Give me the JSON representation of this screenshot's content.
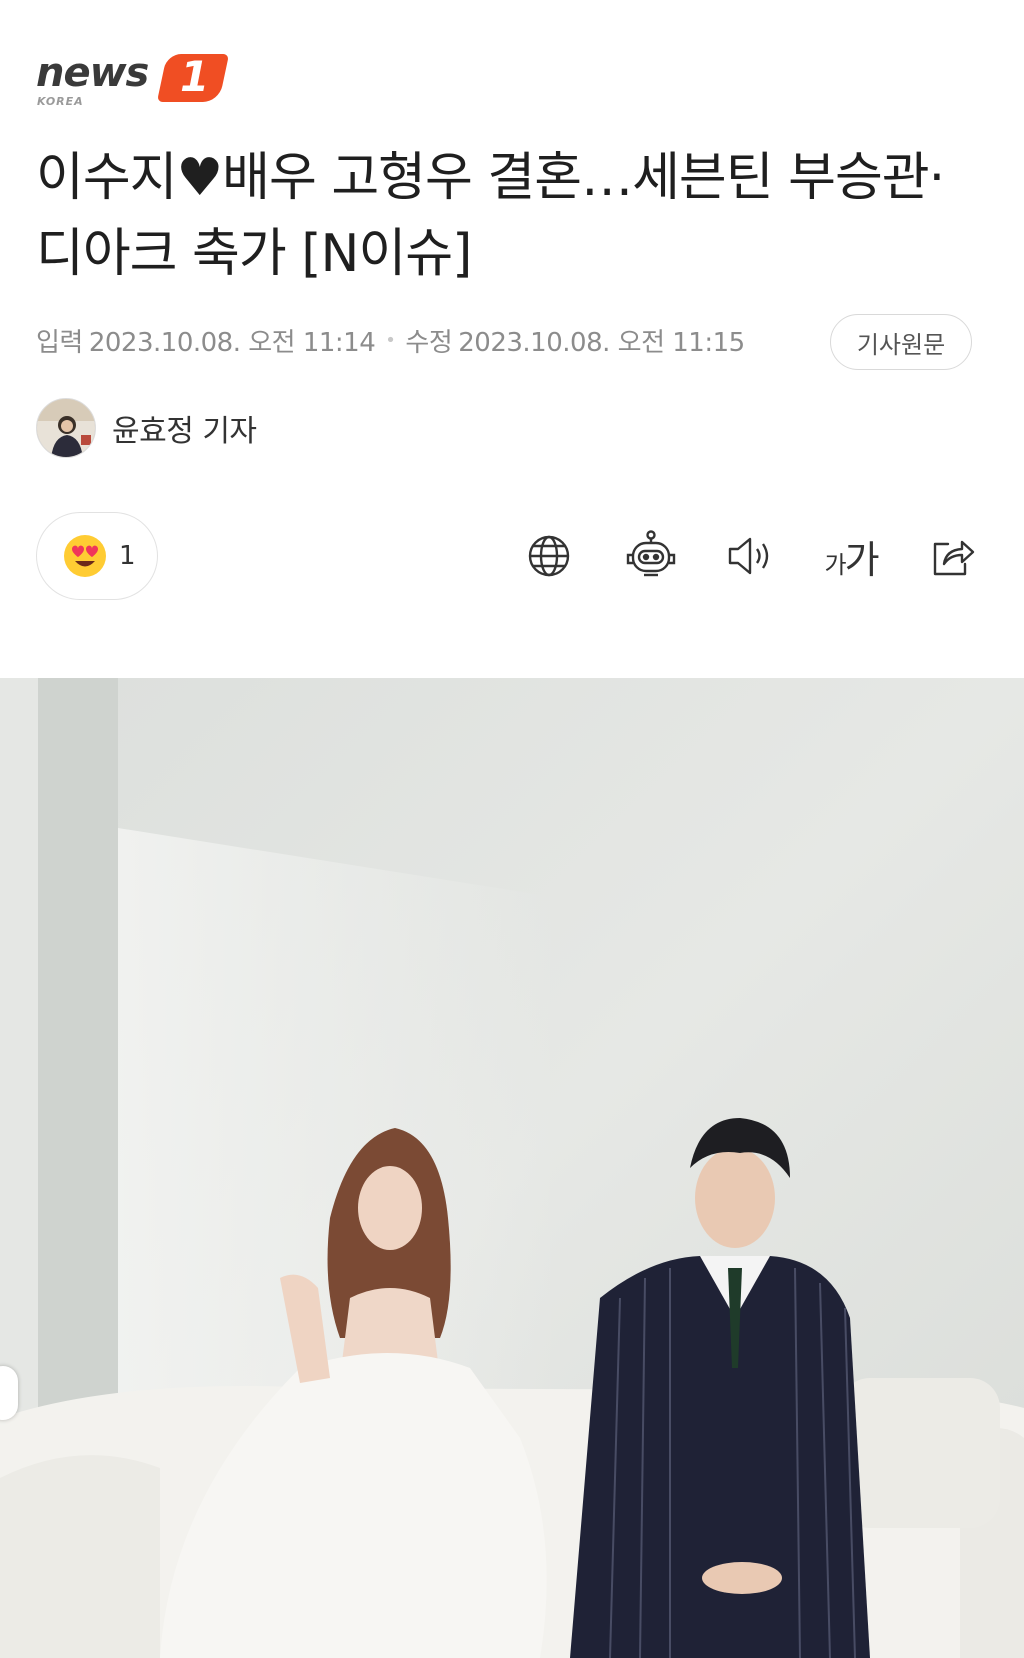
{
  "brand": {
    "logo_text": "news",
    "logo_badge": "1",
    "logo_sub": "KOREA",
    "accent_color": "#f04e23"
  },
  "article": {
    "headline": "이수지♥배우 고형우 결혼…세븐틴 부승관·디아크 축가 [N이슈]",
    "input_label": "입력",
    "input_time": "2023.10.08. 오전 11:14",
    "modified_label": "수정",
    "modified_time": "2023.10.08. 오전 11:15",
    "original_button": "기사원문",
    "author": "윤효정 기자"
  },
  "reaction": {
    "icon": "heart-eyes-emoji-icon",
    "count": "1"
  },
  "toolbar": {
    "icons": [
      "globe-icon",
      "robot-icon",
      "speaker-icon",
      "font-size-icon",
      "share-icon"
    ],
    "font_size_small": "가",
    "font_size_large": "가"
  },
  "photo": {
    "description_icon": "wedding-photo"
  }
}
